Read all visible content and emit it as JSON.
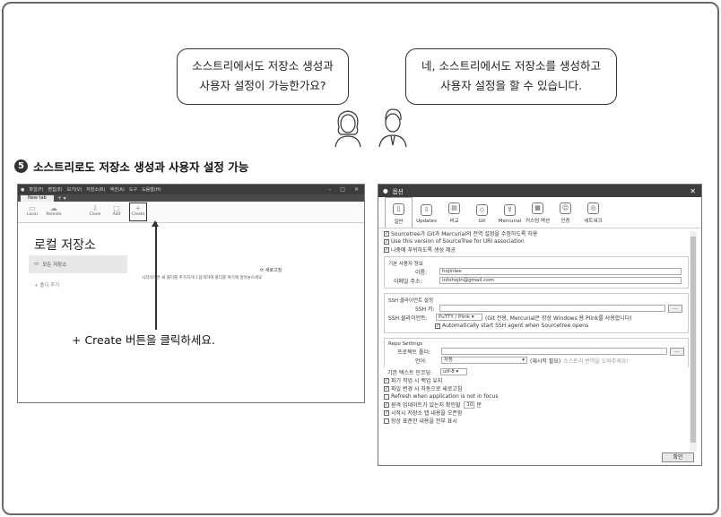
{
  "bubble_left": {
    "line1": "소스트리에서도 저장소 생성과",
    "line2": "사용자 설정이 가능한가요?"
  },
  "bubble_right": {
    "line1": "네, 소스트리에서도 저장소를 생성하고",
    "line2": "사용자 설정을 할 수 있습니다."
  },
  "step": {
    "number": "5",
    "title": "소스트리로도 저장소 생성과 사용자 설정 가능"
  },
  "sourcetree": {
    "menu": [
      "파일(F)",
      "편집(E)",
      "보기(V)",
      "저장소(R)",
      "액션(A)",
      "도구",
      "도움말(H)"
    ],
    "tab": "New tab",
    "tools": [
      {
        "label": "Local",
        "icon": "computer-icon"
      },
      {
        "label": "Remote",
        "icon": "cloud-icon"
      },
      {
        "label": "Clone",
        "icon": "clone-icon"
      },
      {
        "label": "Add",
        "icon": "folder-icon"
      },
      {
        "label": "Create",
        "icon": "plus-icon"
      }
    ],
    "heading": "로컬 저장소",
    "repo_item": "모든 저장소",
    "add_folder": "+ 폴더 추가",
    "hint": "시작하려면 새 폴더를 추가하거나 탐색하여 폴더를 여기에 끌어놓으세요",
    "refresh": "새로고침"
  },
  "create_note": "+ Create 버튼을 클릭하세요.",
  "options": {
    "title": "옵션",
    "tabs": [
      "일반",
      "Updates",
      "비교",
      "Git",
      "Mercurial",
      "커스텀 액션",
      "인증",
      "네트워크"
    ],
    "general_checks": [
      {
        "label": "Sourcetree가 Git과 Mercurial의 전역 설정을 수정하도록 허용",
        "checked": true
      },
      {
        "label": "Use this version of SourceTree for URI association",
        "checked": true
      },
      {
        "label": "나중에 푸쉬하도록 생성 제공",
        "checked": true
      }
    ],
    "user_info": {
      "heading": "기본 사용자 정보",
      "name_label": "이름:",
      "name_value": "hojinlee",
      "email_label": "이메일 주소:",
      "email_value": "infohojin@gmail.com"
    },
    "ssh": {
      "heading": "SSH 클라이언트 설정",
      "key_label": "SSH 키:",
      "client_label": "SSH 클라이언트:",
      "client_value": "PuTTY / Plink",
      "client_note": "(Git 전용, Mercurial은 항상 Windows 용 Plink를 사용합니다)",
      "agent_label": "Automatically start SSH agent when Sourcetree opens",
      "browse": "..."
    },
    "repo": {
      "heading": "Repo Settings",
      "project_label": "프로젝트 폴더:",
      "lang_label": "언어:",
      "lang_value": "자동",
      "lang_note": "(재시작 필요)",
      "lang_help": "소스트리 번역을 도와주세요!",
      "encoding_label": "기본 텍스트 인코딩:",
      "encoding_value": "utf-8",
      "browse": "..."
    },
    "more_checks": [
      {
        "label": "파기 작업 시 백업 유지",
        "checked": true
      },
      {
        "label": "파일 변경 시 자동으로 새로고침",
        "checked": true
      },
      {
        "label": "Refresh when application is not in focus",
        "checked": false
      },
      {
        "label": "원격 업데이트가 있는지 확인할",
        "checked": true,
        "minutes": "10",
        "suffix": "분"
      },
      {
        "label": "시작시 저장소 탭 내용을 오픈함",
        "checked": true
      },
      {
        "label": "항상 표준한 내용을 전부 표시",
        "checked": false
      }
    ],
    "confirm": "확인"
  }
}
